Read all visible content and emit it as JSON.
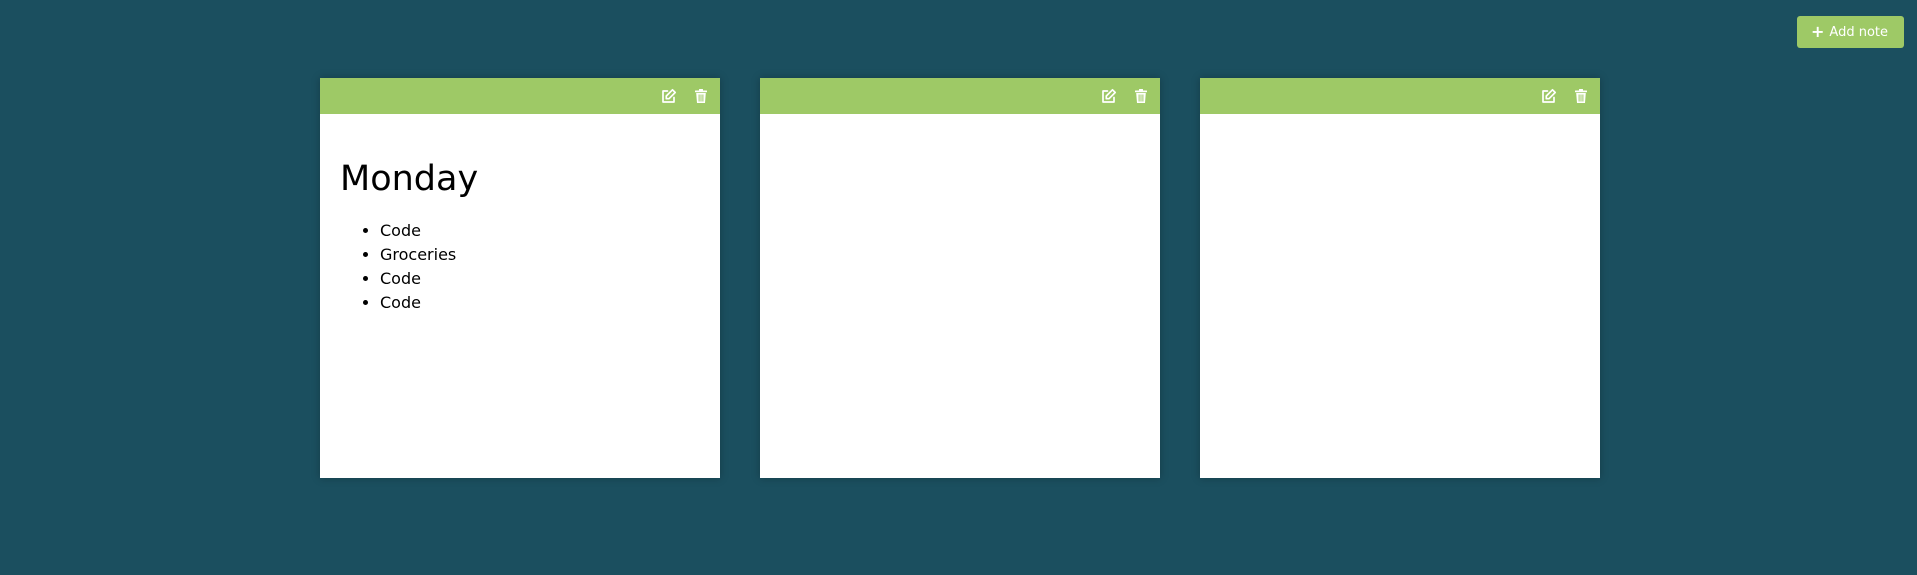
{
  "toolbar": {
    "add_note_label": "Add note",
    "add_icon": "plus-icon"
  },
  "colors": {
    "background": "#1b4f5f",
    "accent": "#9ec966",
    "note_bg": "#ffffff"
  },
  "notes": [
    {
      "title": "Monday",
      "items": [
        "Code",
        "Groceries",
        "Code",
        "Code"
      ],
      "edit_icon": "edit-icon",
      "delete_icon": "trash-icon"
    },
    {
      "title": "",
      "items": [],
      "edit_icon": "edit-icon",
      "delete_icon": "trash-icon"
    },
    {
      "title": "",
      "items": [],
      "edit_icon": "edit-icon",
      "delete_icon": "trash-icon"
    }
  ]
}
